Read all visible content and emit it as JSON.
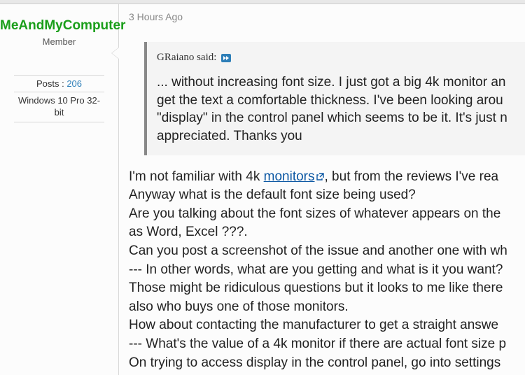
{
  "sidebar": {
    "username": "MeAndMyComputer",
    "role": "Member",
    "posts_label": "Posts :",
    "posts_count": "206",
    "os_info": "Windows 10 Pro 32-bit"
  },
  "post": {
    "timestamp": "3 Hours Ago",
    "quote": {
      "author_said": "GRaiano said:",
      "body": "... without increasing font size. I just got a big 4k monitor an\nget the text a comfortable thickness. I've been looking arou\n\"display\" in the control panel which seems to be it. It's just n\nappreciated. Thanks you"
    },
    "body": {
      "prefix1": "I'm not familiar with 4k ",
      "link_monitors": "monitors",
      "suffix1": ", but from the reviews I've rea",
      "line2": "Anyway what is the default font size being used?",
      "line3": "Are you talking about the font sizes of whatever appears on the",
      "line4": "as Word, Excel ???.",
      "line5": "Can you post a screenshot of the issue and another one with wh",
      "line6": "--- In other words, what are you getting and what is it you want?",
      "line7": "Those might be ridiculous questions but it looks to me like there",
      "line8": "also who buys one of those monitors.",
      "line9": "How about contacting the manufacturer to get a straight answe",
      "line10": "--- What's the value of a 4k monitor if there are actual font size p",
      "line11": "On trying to access display in the control panel, go into settings"
    }
  }
}
